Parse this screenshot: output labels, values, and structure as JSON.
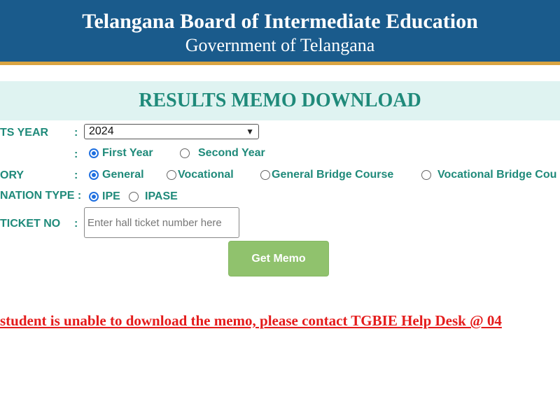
{
  "header": {
    "title": "Telangana Board of Intermediate Education",
    "subtitle": "Government of Telangana"
  },
  "banner": {
    "title": "RESULTS MEMO DOWNLOAD"
  },
  "form": {
    "results_year": {
      "label": "TS YEAR",
      "colon": ":",
      "selected": "2024"
    },
    "year": {
      "colon": ":",
      "options": [
        {
          "label": "First Year",
          "checked": true
        },
        {
          "label": "Second Year",
          "checked": false
        }
      ]
    },
    "category": {
      "label": "ORY",
      "colon": ":",
      "options": [
        {
          "label": "General",
          "checked": true
        },
        {
          "label": "Vocational",
          "checked": false
        },
        {
          "label": "General Bridge Course",
          "checked": false
        },
        {
          "label": "Vocational Bridge Cou",
          "checked": false
        }
      ]
    },
    "exam_type": {
      "label": "NATION TYPE :",
      "options": [
        {
          "label": "IPE",
          "checked": true
        },
        {
          "label": "IPASE",
          "checked": false
        }
      ]
    },
    "hall_ticket": {
      "label": "TICKET NO",
      "colon": ":",
      "placeholder": "Enter hall ticket number here",
      "value": ""
    },
    "submit_label": "Get Memo"
  },
  "notice": "student is unable to download the memo, please contact TGBIE Help Desk @ 04",
  "colors": {
    "header_bg": "#1a5b8c",
    "accent_text": "#1f8a7a",
    "button_bg": "#90c26d",
    "notice_text": "#e41b1b",
    "radio_checked": "#1e6fe0"
  }
}
